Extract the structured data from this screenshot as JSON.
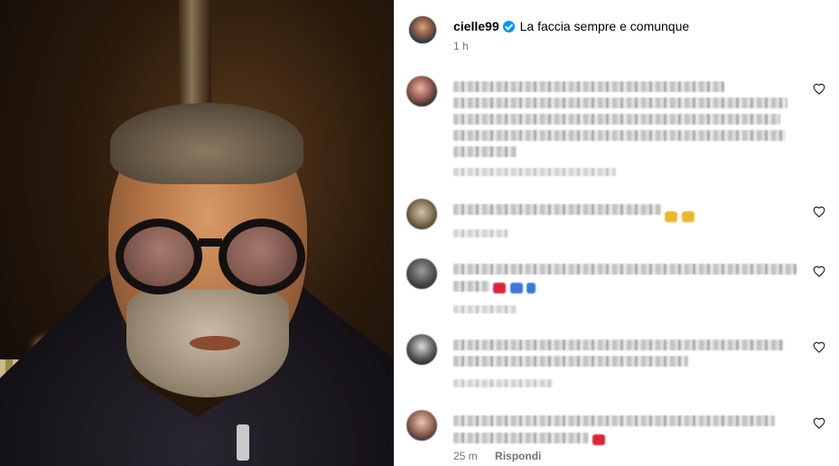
{
  "post": {
    "username": "cielle99",
    "verified": true,
    "caption": "La faccia sempre e comunque",
    "time": "1 h"
  },
  "comments": [
    {
      "time_text": "",
      "reply_text": "",
      "blurred": true
    },
    {
      "time_text": "",
      "reply_text": "",
      "blurred": true
    },
    {
      "time_text": "",
      "reply_text": "",
      "blurred": true
    },
    {
      "time_text": "",
      "reply_text": "",
      "blurred": true
    },
    {
      "time_text": "25 m",
      "reply_text": "Rispondi",
      "blurred": true
    }
  ],
  "icons": {
    "like": "heart-outline-icon",
    "verified": "verified-badge-icon"
  },
  "colors": {
    "verified_blue": "#0095f6",
    "muted_text": "#737373",
    "emoji_red": "#d8263a",
    "emoji_blue": "#3a78d8",
    "emoji_yellow": "#e9b730"
  }
}
